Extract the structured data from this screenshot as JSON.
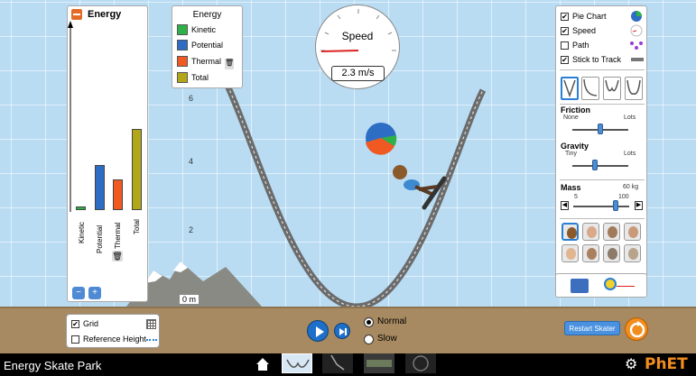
{
  "app": {
    "title": "Energy Skate Park"
  },
  "scene": {
    "height_labels": [
      "6",
      "4",
      "2"
    ],
    "zero_label": "0 m"
  },
  "energy_graph": {
    "title": "Energy",
    "bars": [
      {
        "name": "Kinetic",
        "level": 0.02,
        "color": "#2fb14a"
      },
      {
        "name": "Potential",
        "level": 0.24,
        "color": "#2e6dc4"
      },
      {
        "name": "Thermal",
        "level": 0.16,
        "color": "#f05a22"
      },
      {
        "name": "Total",
        "level": 0.43,
        "color": "#b1a719"
      }
    ]
  },
  "legend": {
    "title": "Energy",
    "items": [
      {
        "label": "Kinetic",
        "color": "#2fb14a"
      },
      {
        "label": "Potential",
        "color": "#2e6dc4"
      },
      {
        "label": "Thermal",
        "color": "#f05a22"
      },
      {
        "label": "Total",
        "color": "#b1a719"
      }
    ]
  },
  "speedometer": {
    "label": "Speed",
    "value": "2.3 m/s"
  },
  "options": {
    "pie_chart": {
      "label": "Pie Chart",
      "checked": true
    },
    "speed": {
      "label": "Speed",
      "checked": true
    },
    "path": {
      "label": "Path",
      "checked": false
    },
    "stick_to_track": {
      "label": "Stick to Track",
      "checked": true
    }
  },
  "friction": {
    "title": "Friction",
    "min": "None",
    "max": "Lots",
    "level": 0.5
  },
  "gravity": {
    "title": "Gravity",
    "min": "Tiny",
    "max": "Lots",
    "level": 0.4
  },
  "mass": {
    "title": "Mass",
    "value": "60 kg",
    "min": "5",
    "max": "100",
    "level": 0.75
  },
  "controls": {
    "grid": {
      "label": "Grid",
      "checked": true
    },
    "reference_height": {
      "label": "Reference Height",
      "checked": false
    },
    "speed_normal": "Normal",
    "speed_slow": "Slow",
    "restart": "Restart Skater"
  },
  "branding": {
    "logo": "PhET"
  }
}
